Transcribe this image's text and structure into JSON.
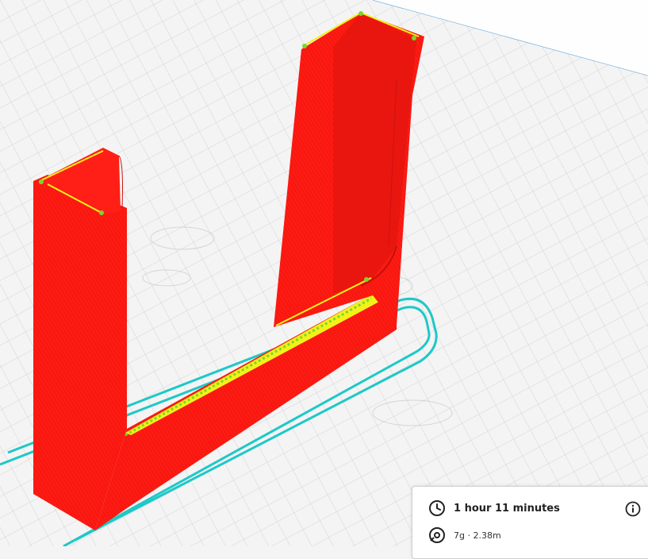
{
  "estimate_panel": {
    "print_time": "1 hour 11 minutes",
    "material_usage": "7g · 2.38m"
  },
  "icons": {
    "clock": "clock-icon",
    "spool": "spool-icon",
    "info": "info-icon"
  },
  "colors": {
    "build_plate": "#f4f4f4",
    "grid_line": "#d2d2d2",
    "wall_outer": "#ff1a12",
    "wall_shade": "#e0140f",
    "infill": "#f2f218",
    "travel": "#7ad62f",
    "skirt": "#1ec8c8",
    "edge": "#5aa0d8"
  }
}
